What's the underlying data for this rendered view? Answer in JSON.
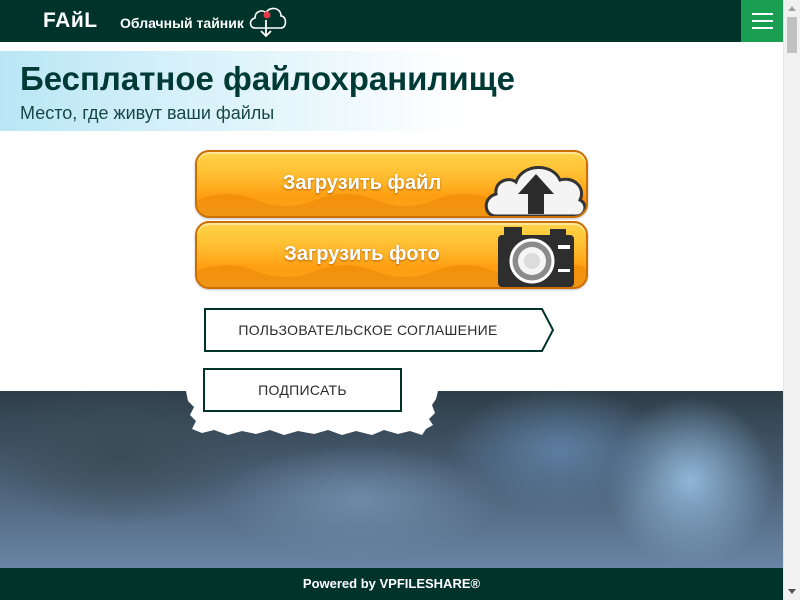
{
  "header": {
    "logo_text": "FAйL",
    "tagline": "Облачный тайник",
    "colors": {
      "background": "#003329",
      "menu_button": "#1a9e52"
    }
  },
  "hero": {
    "title": "Бесплатное файлохранилище",
    "subtitle": "Место, где живут ваши файлы"
  },
  "upload_buttons": [
    {
      "label": "Загрузить файл",
      "icon": "cloud-upload-icon"
    },
    {
      "label": "Загрузить фото",
      "icon": "camera-icon"
    }
  ],
  "links": {
    "agreement_label": "ПОЛЬЗОВАТЕЛЬСКОЕ СОГЛАШЕНИЕ",
    "sign_label": "ПОДПИСАТЬ"
  },
  "footer": {
    "powered_by": "Powered by VPFILESHARE®"
  },
  "colors": {
    "button_orange": "#ffb72a",
    "title_text": "#003a36",
    "outline": "#003329"
  }
}
